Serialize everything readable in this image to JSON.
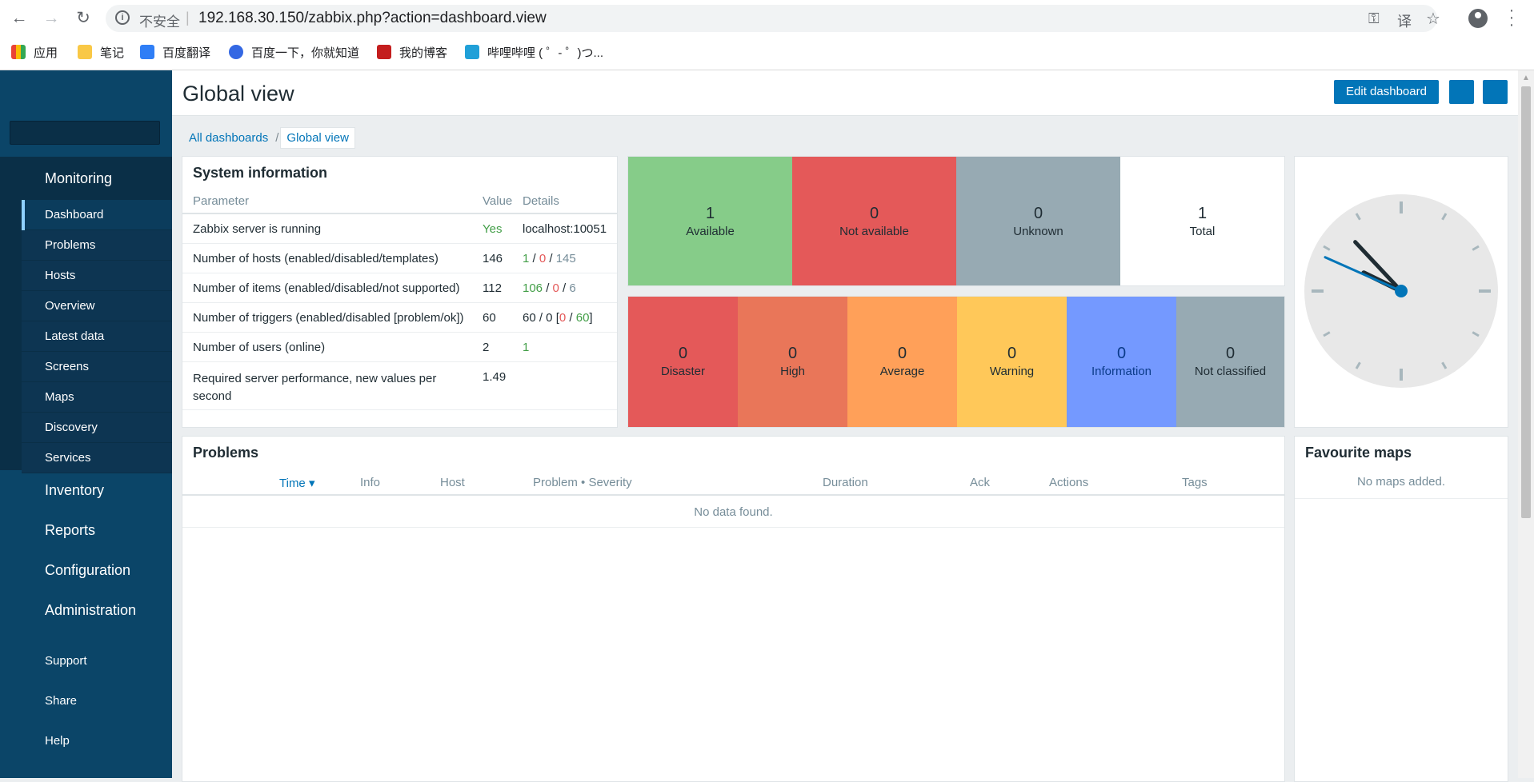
{
  "browser": {
    "insecure_label": "不安全",
    "url": "192.168.30.150/zabbix.php?action=dashboard.view",
    "bookmarks": [
      {
        "label": "应用",
        "icon": "apps-grid-icon"
      },
      {
        "label": "笔记",
        "icon": "folder-icon"
      },
      {
        "label": "百度翻译",
        "icon": "translate-icon"
      },
      {
        "label": "百度一下，你就知道",
        "icon": "baidu-paw-icon"
      },
      {
        "label": "我的博客",
        "icon": "csdn-icon"
      },
      {
        "label": "哔哩哔哩 ( ゜- ゜)つ...",
        "icon": "bilibili-icon"
      }
    ]
  },
  "sidebar": {
    "menu": [
      {
        "label": "Monitoring"
      },
      {
        "label": "Inventory"
      },
      {
        "label": "Reports"
      },
      {
        "label": "Configuration"
      },
      {
        "label": "Administration"
      }
    ],
    "submenu": [
      {
        "label": "Dashboard"
      },
      {
        "label": "Problems"
      },
      {
        "label": "Hosts"
      },
      {
        "label": "Overview"
      },
      {
        "label": "Latest data"
      },
      {
        "label": "Screens"
      },
      {
        "label": "Maps"
      },
      {
        "label": "Discovery"
      },
      {
        "label": "Services"
      }
    ],
    "footer": [
      {
        "label": "Support"
      },
      {
        "label": "Share"
      },
      {
        "label": "Help"
      }
    ]
  },
  "header": {
    "title": "Global view",
    "edit_label": "Edit dashboard"
  },
  "breadcrumb": {
    "all": "All dashboards",
    "separator": "/",
    "current": "Global view"
  },
  "system_info": {
    "title": "System information",
    "headers": {
      "param": "Parameter",
      "value": "Value",
      "details": "Details"
    },
    "rows": [
      {
        "param": "Zabbix server is running",
        "value": "Yes",
        "details": "localhost:10051"
      },
      {
        "param": "Number of hosts (enabled/disabled/templates)",
        "value": "146",
        "d1": "1",
        "d2": "0",
        "d3": "145"
      },
      {
        "param": "Number of items (enabled/disabled/not supported)",
        "value": "112",
        "d1": "106",
        "d2": "0",
        "d3": "6"
      },
      {
        "param": "Number of triggers (enabled/disabled [problem/ok])",
        "value": "60",
        "d1": "60 / 0 [",
        "d2": "0",
        "d3": "60",
        "d4": "]"
      },
      {
        "param": "Number of users (online)",
        "value": "2",
        "details": "1"
      },
      {
        "param": "Required server performance, new values per second",
        "value": "1.49"
      }
    ]
  },
  "host_availability": [
    {
      "count": "1",
      "label": "Available",
      "color": "#86cc89"
    },
    {
      "count": "0",
      "label": "Not available",
      "color": "#e45959"
    },
    {
      "count": "0",
      "label": "Unknown",
      "color": "#97aab3"
    },
    {
      "count": "1",
      "label": "Total",
      "color": "#ffffff"
    }
  ],
  "problems_by_severity": [
    {
      "count": "0",
      "label": "Disaster",
      "color": "#e45959"
    },
    {
      "count": "0",
      "label": "High",
      "color": "#e97659"
    },
    {
      "count": "0",
      "label": "Average",
      "color": "#ffa059"
    },
    {
      "count": "0",
      "label": "Warning",
      "color": "#ffc859"
    },
    {
      "count": "0",
      "label": "Information",
      "color": "#7499ff"
    },
    {
      "count": "0",
      "label": "Not classified",
      "color": "#97aab3"
    }
  ],
  "problems": {
    "title": "Problems",
    "columns": [
      "Time ▾",
      "Info",
      "Host",
      "Problem • Severity",
      "Duration",
      "Ack",
      "Actions",
      "Tags"
    ],
    "empty": "No data found."
  },
  "favourite_maps": {
    "title": "Favourite maps",
    "empty": "No maps added."
  },
  "clock": {
    "hour": 9,
    "minute": 52,
    "second": 49
  }
}
